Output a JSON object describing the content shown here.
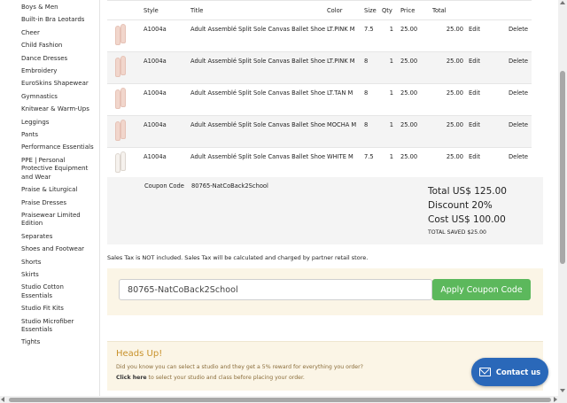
{
  "sidebar": {
    "items": [
      "Boys & Men",
      "Built-in Bra Leotards",
      "Cheer",
      "Child Fashion",
      "Dance Dresses",
      "Embroidery",
      "EuroSkins Shapewear",
      "Gymnastics",
      "Knitwear & Warm-Ups",
      "Leggings",
      "Pants",
      "Performance Essentials",
      "PPE | Personal Protective Equipment and Wear",
      "Praise & Liturgical",
      "Praise Dresses",
      "Praisewear Limited Edition",
      "Separates",
      "Shoes and Footwear",
      "Shorts",
      "Skirts",
      "Studio Cotton Essentials",
      "Studio Fit Kits",
      "Studio Microfiber Essentials",
      "Tights"
    ]
  },
  "cart": {
    "headers": {
      "style": "Style",
      "title": "Title",
      "color": "Color",
      "size": "Size",
      "qty": "Qty",
      "price": "Price",
      "total": "Total"
    },
    "rows": [
      {
        "style": "A1004a",
        "title": "Adult Assemblé Split Sole Canvas Ballet Shoe",
        "color": "LT.PINK M",
        "size": "7.5",
        "qty": "1",
        "price": "25.00",
        "total": "25.00",
        "edit": "Edit",
        "delete": "Delete"
      },
      {
        "style": "A1004a",
        "title": "Adult Assemblé Split Sole Canvas Ballet Shoe",
        "color": "LT.PINK M",
        "size": "8",
        "qty": "1",
        "price": "25.00",
        "total": "25.00",
        "edit": "Edit",
        "delete": "Delete"
      },
      {
        "style": "A1004a",
        "title": "Adult Assemblé Split Sole Canvas Ballet Shoe",
        "color": "LT.TAN M",
        "size": "8",
        "qty": "1",
        "price": "25.00",
        "total": "25.00",
        "edit": "Edit",
        "delete": "Delete"
      },
      {
        "style": "A1004a",
        "title": "Adult Assemblé Split Sole Canvas Ballet Shoe",
        "color": "MOCHA M",
        "size": "8",
        "qty": "1",
        "price": "25.00",
        "total": "25.00",
        "edit": "Edit",
        "delete": "Delete"
      },
      {
        "style": "A1004a",
        "title": "Adult Assemblé Split Sole Canvas Ballet Shoe",
        "color": "WHITE M",
        "size": "7.5",
        "qty": "1",
        "price": "25.00",
        "total": "25.00",
        "edit": "Edit",
        "delete": "Delete"
      }
    ],
    "coupon_label": "Coupon Code",
    "coupon_code": "80765-NatCoBack2School",
    "summary": {
      "total": "Total US$ 125.00",
      "discount": "Discount 20%",
      "cost": "Cost US$ 100.00",
      "saved": "TOTAL SAVED $25.00"
    }
  },
  "tax_note": "Sales Tax is NOT included. Sales Tax will be calculated and charged by partner retail store.",
  "coupon_form": {
    "value": "80765-NatCoBack2School",
    "button": "Apply Coupon Code"
  },
  "heads_up": {
    "title": "Heads Up!",
    "text1": "Did you know you can select a studio and they get a 5% reward for everything you order?",
    "link": "Click here",
    "text2": " to select your studio and class before placing your order."
  },
  "contact": {
    "label": "Contact us",
    "icon": "mail-icon"
  },
  "colors": {
    "apply_button": "#5cb85c",
    "panel_bg": "#fbf5e6",
    "contact_button": "#2a68b9",
    "heads_up_title": "#c8922c"
  }
}
